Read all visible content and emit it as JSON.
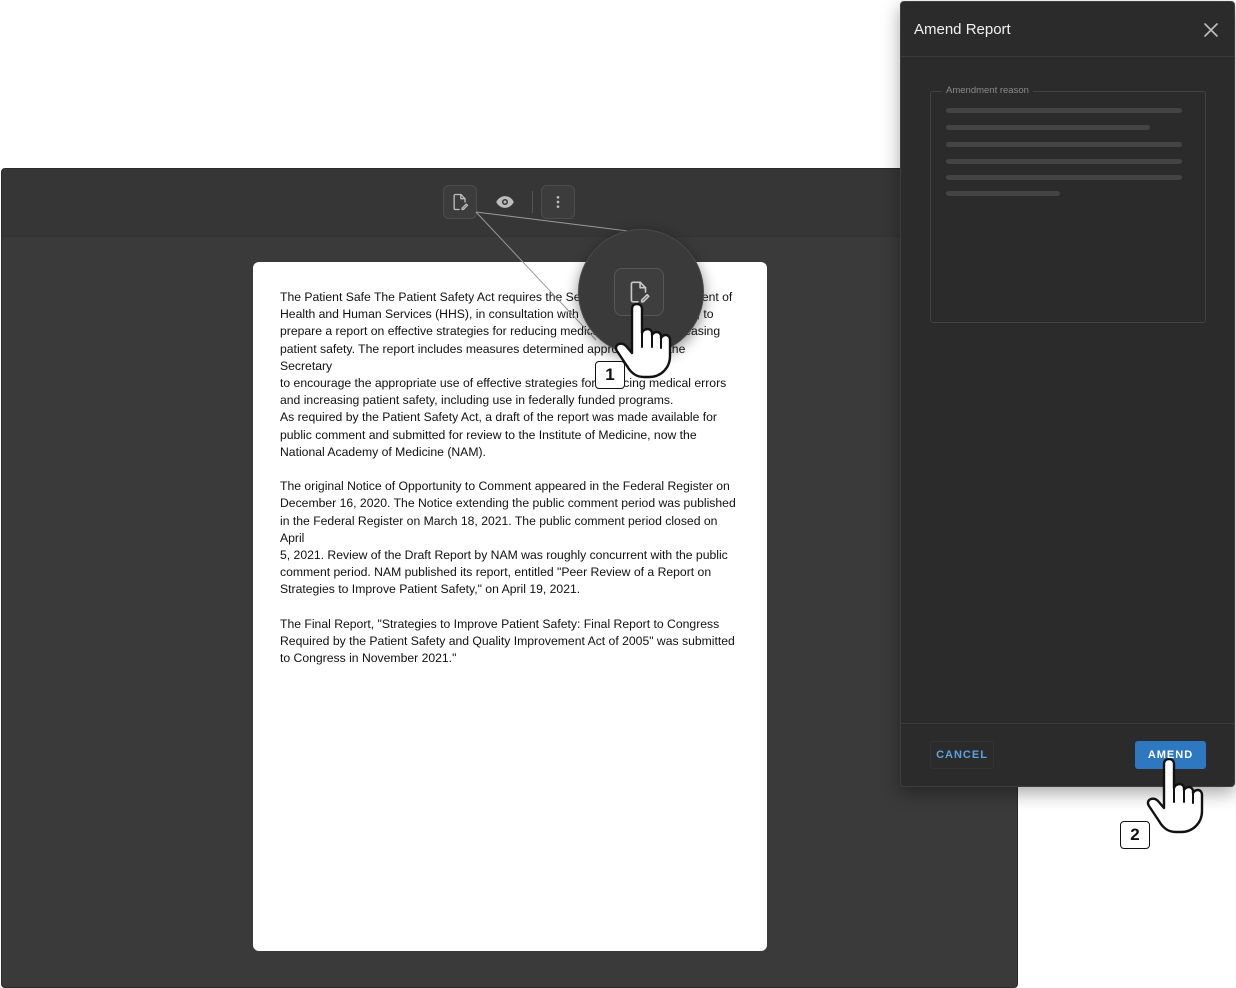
{
  "viewer": {
    "toolbar": {
      "edit_icon": "file-edit-icon",
      "view_icon": "eye-icon",
      "more_icon": "more-vertical-icon"
    },
    "document": {
      "paragraphs": [
        "The Patient Safe The Patient Safety Act requires the Secretary of the Department of\nHealth and Human Services (HHS), in consultation with the Director of AHRQ, to\nprepare a report on effective strategies for reducing medical errors and increasing\npatient safety. The report includes measures determined appropriate by the Secretary\nto encourage the appropriate use of effective strategies for reducing medical errors\nand increasing patient safety, including use in federally funded programs.\nAs required by the Patient Safety Act, a draft of the report was made available for\npublic comment and submitted for review to the Institute of Medicine, now the\nNational Academy of Medicine (NAM).",
        "The original Notice of Opportunity to Comment appeared in the Federal Register on\nDecember 16, 2020. The Notice extending the public comment period was published\nin the Federal Register on March 18, 2021. The public comment period closed on April\n5, 2021. Review of the Draft Report by NAM was roughly concurrent with the public\ncomment period. NAM published its report, entitled \"Peer Review of a Report on\nStrategies to Improve Patient Safety,\" on April 19, 2021.",
        "The Final Report, \"Strategies to Improve Patient Safety: Final Report to Congress\nRequired by the Patient Safety and Quality Improvement Act of 2005\" was submitted\nto Congress in November 2021.\""
      ]
    }
  },
  "steps": {
    "one": "1",
    "two": "2"
  },
  "dialog": {
    "title": "Amend Report",
    "close_icon": "close-icon",
    "field_label": "Amendment reason",
    "cancel_label": "CANCEL",
    "amend_label": "AMEND"
  },
  "colors": {
    "viewer_bg": "#3a3a3a",
    "dialog_bg": "#2b2b2b",
    "accent": "#2e78c2",
    "link": "#5aa3e3"
  }
}
